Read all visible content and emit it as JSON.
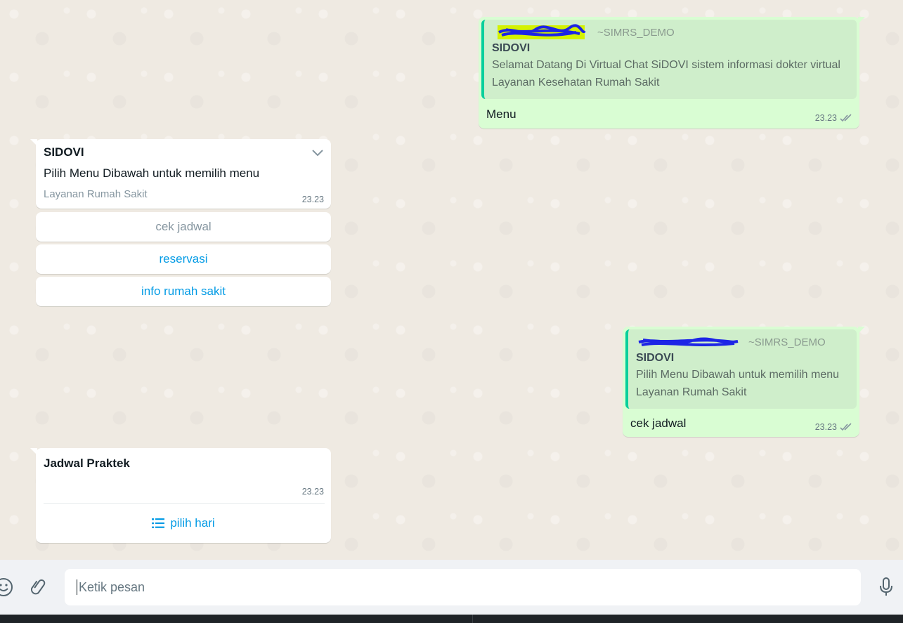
{
  "colors": {
    "chat_bg": "#efeae2",
    "outgoing_bubble": "#d9fdd3",
    "incoming_bubble": "#ffffff",
    "quote_accent": "#06cf9c",
    "link_blue": "#039be5",
    "composer_bg": "#f0f2f5"
  },
  "messages": {
    "out1": {
      "quote_sender": "~SIMRS_DEMO",
      "quote_title": "SIDOVI",
      "quote_body": "Selamat Datang Di Virtual Chat SiDOVI sistem informasi dokter virtual",
      "quote_footer": "Layanan Kesehatan Rumah Sakit",
      "text": "Menu",
      "time": "23.23",
      "status_icon": "double-check-icon"
    },
    "in1": {
      "title": "SIDOVI",
      "body": "Pilih Menu Dibawah untuk memilih menu",
      "footer": "Layanan Rumah Sakit",
      "time": "23.23",
      "menu_icon": "chevron-down-icon",
      "buttons": [
        "cek jadwal",
        "reservasi",
        "info rumah sakit"
      ]
    },
    "out2": {
      "quote_sender": "~SIMRS_DEMO",
      "quote_title": "SIDOVI",
      "quote_body": "Pilih Menu Dibawah untuk memilih menu",
      "quote_footer": "Layanan Rumah Sakit",
      "text": "cek jadwal",
      "time": "23.23",
      "status_icon": "double-check-icon"
    },
    "in2": {
      "title": "Jadwal Praktek",
      "time": "23.23",
      "list_button_icon": "list-icon",
      "list_button": "pilih hari"
    }
  },
  "composer": {
    "placeholder": "Ketik pesan",
    "emoji_icon": "emoji-icon",
    "attach_icon": "paperclip-icon",
    "mic_icon": "microphone-icon"
  }
}
